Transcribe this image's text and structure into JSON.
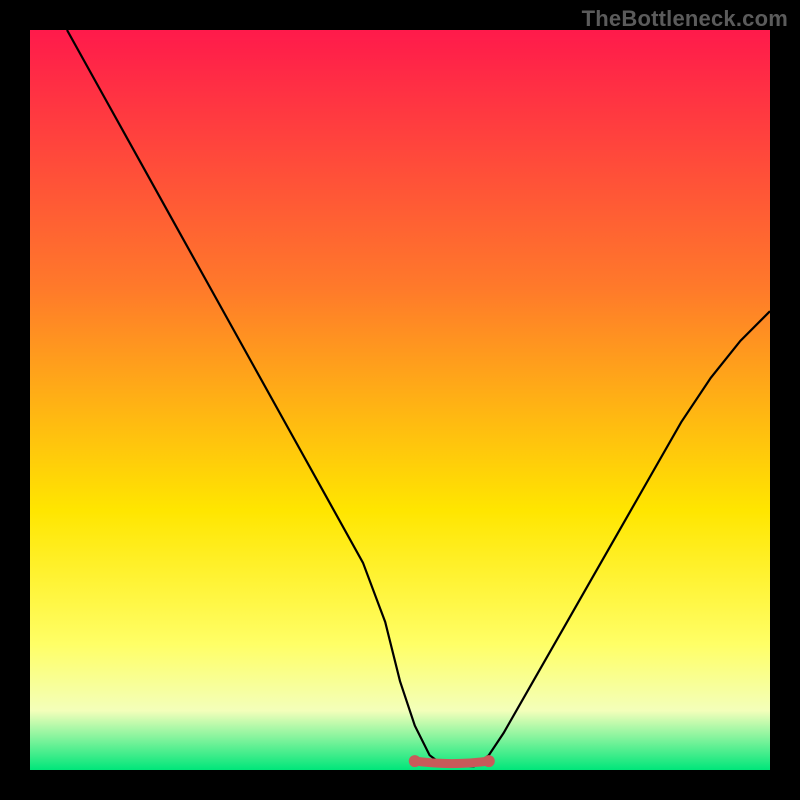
{
  "watermark": "TheBottleneck.com",
  "colors": {
    "gradient_top": "#ff1a4b",
    "gradient_mid1": "#ff7a2a",
    "gradient_mid2": "#ffe600",
    "gradient_low": "#f3ffba",
    "gradient_bottom": "#00e67a",
    "curve": "#000000",
    "marker": "#c85a5a",
    "frame": "#000000"
  },
  "chart_data": {
    "type": "line",
    "title": "",
    "xlabel": "",
    "ylabel": "",
    "xlim": [
      0,
      100
    ],
    "ylim": [
      0,
      100
    ],
    "series": [
      {
        "name": "bottleneck-curve",
        "x": [
          5,
          10,
          15,
          20,
          25,
          30,
          35,
          40,
          45,
          48,
          50,
          52,
          54,
          56,
          58,
          60,
          62,
          64,
          68,
          72,
          76,
          80,
          84,
          88,
          92,
          96,
          100
        ],
        "values": [
          100,
          91,
          82,
          73,
          64,
          55,
          46,
          37,
          28,
          20,
          12,
          6,
          2,
          0.5,
          0.5,
          0.5,
          2,
          5,
          12,
          19,
          26,
          33,
          40,
          47,
          53,
          58,
          62
        ]
      }
    ],
    "flat_zone": {
      "x_start": 52,
      "x_end": 62,
      "y": 1.2
    },
    "annotations": []
  }
}
